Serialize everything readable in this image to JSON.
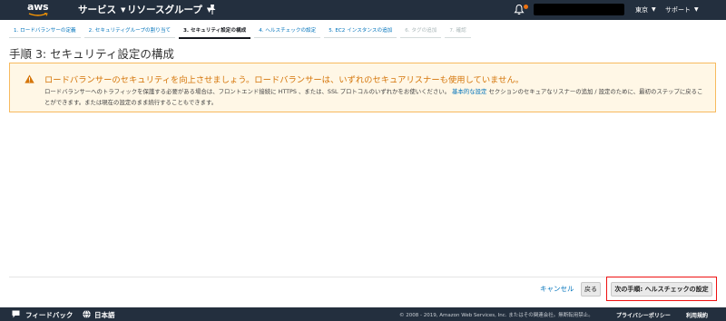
{
  "brand": {
    "logo_text": "aws"
  },
  "nav": {
    "services_label": "サービス",
    "resource_groups_label": "リソースグループ",
    "region_label": "東京",
    "support_label": "サポート"
  },
  "steps": [
    {
      "label": "1. ロードバランサーの定義",
      "state": "done"
    },
    {
      "label": "2. セキュリティグループの割り当て",
      "state": "done"
    },
    {
      "label": "3. セキュリティ設定の構成",
      "state": "active"
    },
    {
      "label": "4. ヘルスチェックの設定",
      "state": "next"
    },
    {
      "label": "5. EC2 インスタンスの追加",
      "state": "next"
    },
    {
      "label": "6. タグの追加",
      "state": "disabled"
    },
    {
      "label": "7. 確認",
      "state": "disabled"
    }
  ],
  "page": {
    "title": "手順 3: セキュリティ設定の構成"
  },
  "alert": {
    "title": "ロードバランサーのセキュリティを向上させましょう。ロードバランサーは、いずれのセキュアリスナーも使用していません。",
    "body_part1": "ロードバランサーへのトラフィックを保護する必要がある場合は、フロントエンド接続に HTTPS 、または、SSL プロトコルのいずれかをお使いください。",
    "link_text": "基本的な設定",
    "body_part2": "セクションのセキュアなリスナーの追加 / 設定のために、最初のステップに戻ることができます。または現在の設定のまま続行することもできます。"
  },
  "actions": {
    "cancel_label": "キャンセル",
    "back_label": "戻る",
    "next_label": "次の手順: ヘルスチェックの設定"
  },
  "footer": {
    "feedback_label": "フィードバック",
    "language_label": "日本語",
    "copyright": "© 2008 - 2019, Amazon Web Services, Inc. またはその関連会社。無断転用禁止。",
    "privacy_label": "プライバシーポリシー",
    "terms_label": "利用規約"
  },
  "colors": {
    "header_bg": "#232f3e",
    "accent_orange": "#ec7211",
    "link_blue": "#0073bb",
    "alert_bg": "#fff7e6",
    "alert_border": "#f7ba5f"
  }
}
